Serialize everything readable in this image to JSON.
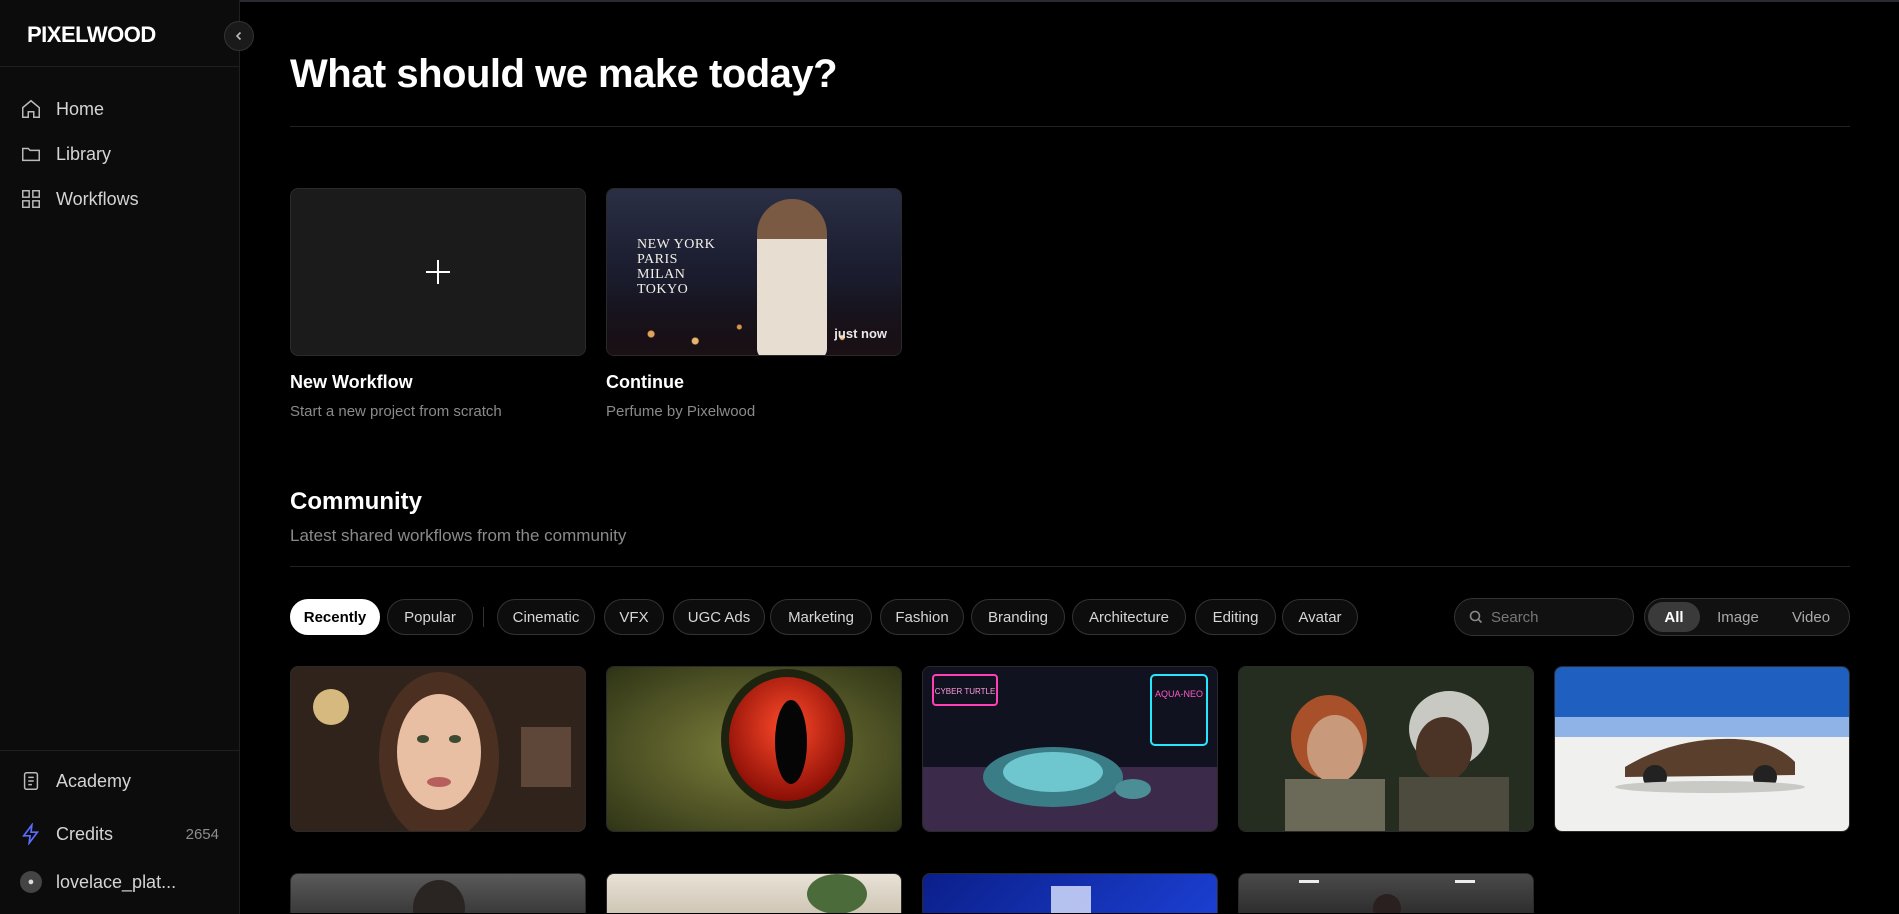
{
  "app": {
    "logo": "PIXELWOOD"
  },
  "sidebar": {
    "nav": [
      {
        "label": "Home",
        "icon": "home-icon"
      },
      {
        "label": "Library",
        "icon": "folder-icon"
      },
      {
        "label": "Workflows",
        "icon": "grid-icon"
      }
    ],
    "bottom": {
      "academy": "Academy",
      "credits_label": "Credits",
      "credits_value": "2654",
      "user": "lovelace_plat..."
    }
  },
  "main": {
    "title": "What should we make today?",
    "tiles": {
      "new_title": "New Workflow",
      "new_sub": "Start a new project from scratch",
      "continue_title": "Continue",
      "continue_sub": "Perfume by Pixelwood",
      "continue_time": "just now",
      "continue_overlay": [
        "NEW YORK",
        "PARIS",
        "MILAN",
        "TOKYO"
      ]
    },
    "community": {
      "title": "Community",
      "subtitle": "Latest shared workflows from the community",
      "sort_chips": [
        "Recently",
        "Popular"
      ],
      "category_chips": [
        "Cinematic",
        "VFX",
        "UGC Ads",
        "Marketing",
        "Fashion",
        "Branding",
        "Architecture",
        "Editing",
        "Avatar"
      ],
      "search_placeholder": "Search",
      "media_filters": [
        "All",
        "Image",
        "Video"
      ],
      "active_sort": "Recently",
      "active_media": "All",
      "card_overlay_text": {
        "turtle_sign1": "CYBER TURTLE",
        "turtle_sign2": "AQUA-NEO"
      }
    }
  },
  "colors": {
    "accent": "#5b6cff",
    "background": "#000000",
    "sidebar": "#0c0c0c"
  }
}
